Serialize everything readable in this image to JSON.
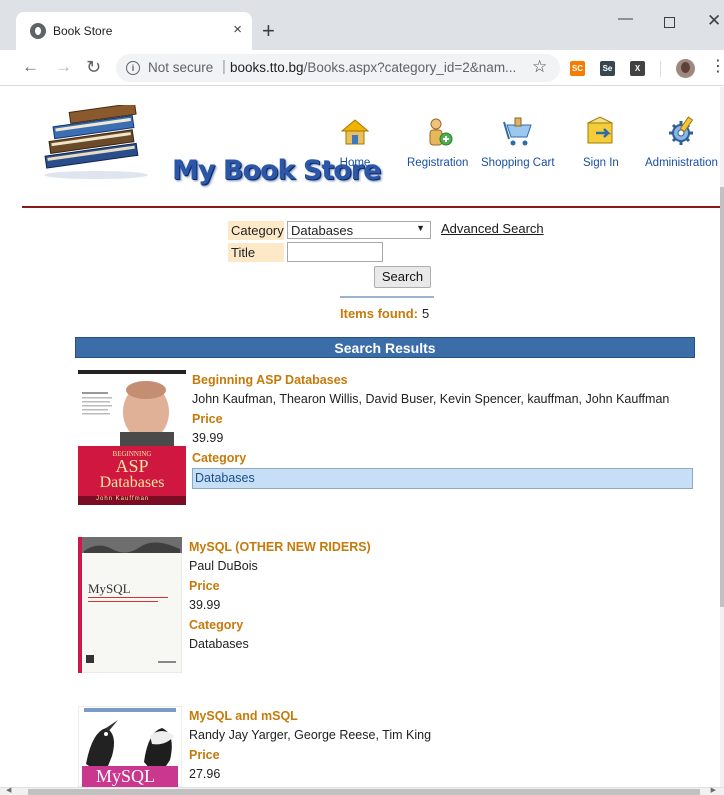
{
  "browser": {
    "tab_title": "Book Store",
    "tab_close": "×",
    "new_tab": "+",
    "security_label": "Not secure",
    "url_host": "books.tto.bg",
    "url_path": "/Books.aspx?category_id=2&nam...",
    "extensions": [
      "SC",
      "Se",
      "X"
    ]
  },
  "site": {
    "logo_text": "My Book Store",
    "nav": [
      {
        "label": "Home",
        "icon": "home-icon"
      },
      {
        "label": "Registration",
        "icon": "registration-icon"
      },
      {
        "label": "Shopping Cart",
        "icon": "shopping-cart-icon"
      },
      {
        "label": "Sign In",
        "icon": "sign-in-icon"
      },
      {
        "label": "Administration",
        "icon": "administration-icon"
      }
    ],
    "colors": {
      "accent": "#c77a0a",
      "bar": "#3b6ea8",
      "rule": "#8b1a1a",
      "label_bg": "#fde9c8"
    }
  },
  "search": {
    "category_label": "Category",
    "category_value": "Databases",
    "advanced_link": "Advanced Search",
    "title_label": "Title",
    "title_value": "",
    "button_label": "Search",
    "items_found_label": "Items found:",
    "items_found_value": "5"
  },
  "results": {
    "header": "Search Results",
    "price_label": "Price",
    "category_label": "Category",
    "books": [
      {
        "title": "Beginning ASP Databases",
        "authors": "John Kaufman, Thearon Willis, David Buser, Kevin Spencer, kauffman, John Kauffman",
        "price": "39.99",
        "category": "Databases",
        "cover_line1": "BEGINNING",
        "cover_line2": "ASP",
        "cover_line3": "Databases",
        "cover_author": "John Kauffman"
      },
      {
        "title": "MySQL (OTHER NEW RIDERS)",
        "authors": "Paul DuBois",
        "price": "39.99",
        "category": "Databases",
        "cover_line1": "MySQL"
      },
      {
        "title": "MySQL and mSQL",
        "authors": "Randy Jay Yarger, George Reese, Tim King",
        "price": "27.96",
        "category": "",
        "cover_line1": "MySQL"
      }
    ]
  }
}
